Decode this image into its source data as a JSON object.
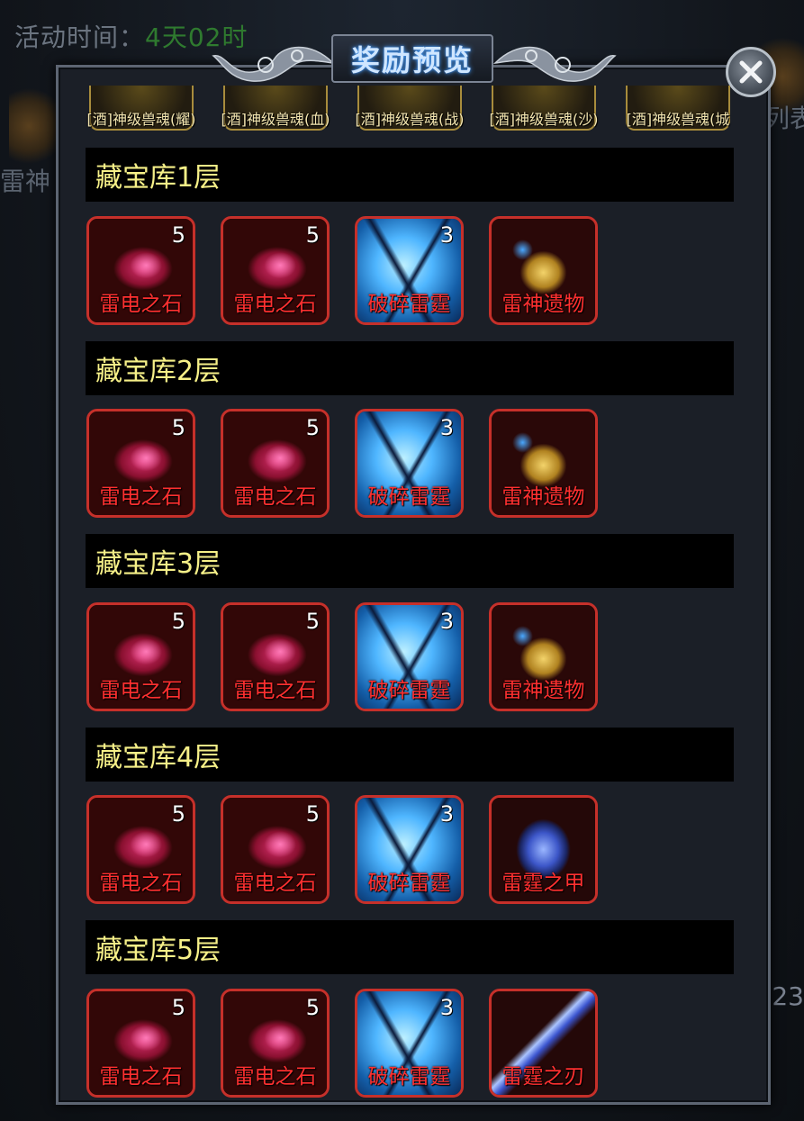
{
  "background": {
    "event_time_label": "活动时间：",
    "event_time_value": "4天02时",
    "left_text": "雷神",
    "right_text": "列表",
    "right_number": "23"
  },
  "dialog": {
    "title": "奖励预览",
    "close_icon": "close-icon"
  },
  "top_rewards": [
    {
      "label": "[酒]神级兽魂(耀)"
    },
    {
      "label": "[酒]神级兽魂(血)"
    },
    {
      "label": "[酒]神级兽魂(战)"
    },
    {
      "label": "[酒]神级兽魂(沙)"
    },
    {
      "label": "[酒]神级兽魂(城"
    }
  ],
  "sections": [
    {
      "title": "藏宝库1层",
      "items": [
        {
          "name": "雷电之石",
          "count": "5",
          "icon": "lightning-stone-icon"
        },
        {
          "name": "雷电之石",
          "count": "5",
          "icon": "lightning-stone-icon"
        },
        {
          "name": "破碎雷霆",
          "count": "3",
          "icon": "shattered-thunder-icon"
        },
        {
          "name": "雷神遗物",
          "count": "",
          "icon": "thunder-god-relic-icon"
        }
      ]
    },
    {
      "title": "藏宝库2层",
      "items": [
        {
          "name": "雷电之石",
          "count": "5",
          "icon": "lightning-stone-icon"
        },
        {
          "name": "雷电之石",
          "count": "5",
          "icon": "lightning-stone-icon"
        },
        {
          "name": "破碎雷霆",
          "count": "3",
          "icon": "shattered-thunder-icon"
        },
        {
          "name": "雷神遗物",
          "count": "",
          "icon": "thunder-god-relic-icon"
        }
      ]
    },
    {
      "title": "藏宝库3层",
      "items": [
        {
          "name": "雷电之石",
          "count": "5",
          "icon": "lightning-stone-icon"
        },
        {
          "name": "雷电之石",
          "count": "5",
          "icon": "lightning-stone-icon"
        },
        {
          "name": "破碎雷霆",
          "count": "3",
          "icon": "shattered-thunder-icon"
        },
        {
          "name": "雷神遗物",
          "count": "",
          "icon": "thunder-god-relic-icon"
        }
      ]
    },
    {
      "title": "藏宝库4层",
      "items": [
        {
          "name": "雷电之石",
          "count": "5",
          "icon": "lightning-stone-icon"
        },
        {
          "name": "雷电之石",
          "count": "5",
          "icon": "lightning-stone-icon"
        },
        {
          "name": "破碎雷霆",
          "count": "3",
          "icon": "shattered-thunder-icon"
        },
        {
          "name": "雷霆之甲",
          "count": "",
          "icon": "thunder-armor-icon"
        }
      ]
    },
    {
      "title": "藏宝库5层",
      "items": [
        {
          "name": "雷电之石",
          "count": "5",
          "icon": "lightning-stone-icon"
        },
        {
          "name": "雷电之石",
          "count": "5",
          "icon": "lightning-stone-icon"
        },
        {
          "name": "破碎雷霆",
          "count": "3",
          "icon": "shattered-thunder-icon"
        },
        {
          "name": "雷霆之刃",
          "count": "",
          "icon": "thunder-blade-icon"
        }
      ]
    }
  ],
  "colors": {
    "section_title": "#f6f088",
    "item_name": "#ff3030",
    "item_border": "#c6302a",
    "title_glow": "#4aa3ff",
    "event_time_value": "#2f7a2f"
  }
}
